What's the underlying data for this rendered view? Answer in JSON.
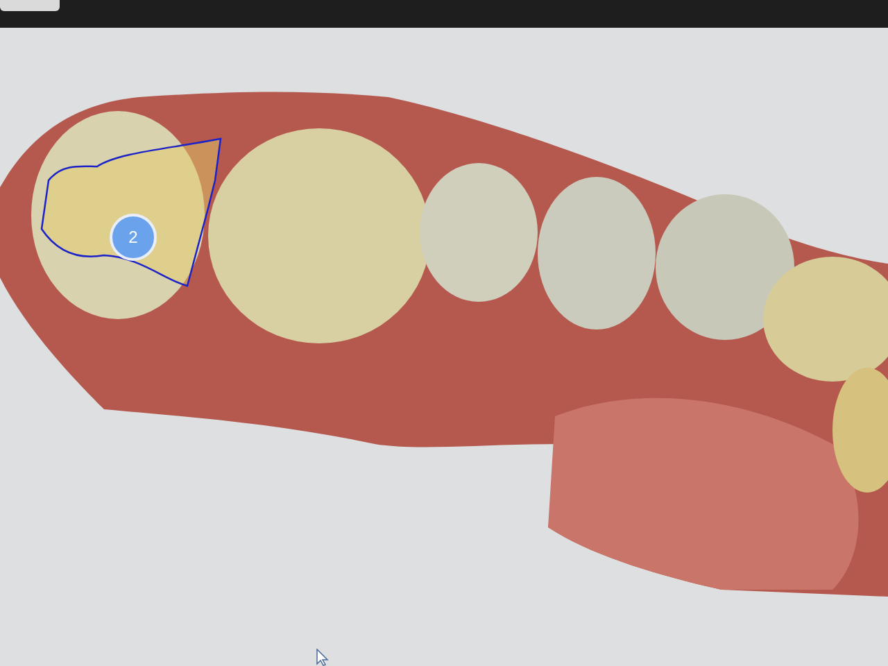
{
  "viewport": {
    "marker": {
      "label": "2"
    }
  }
}
